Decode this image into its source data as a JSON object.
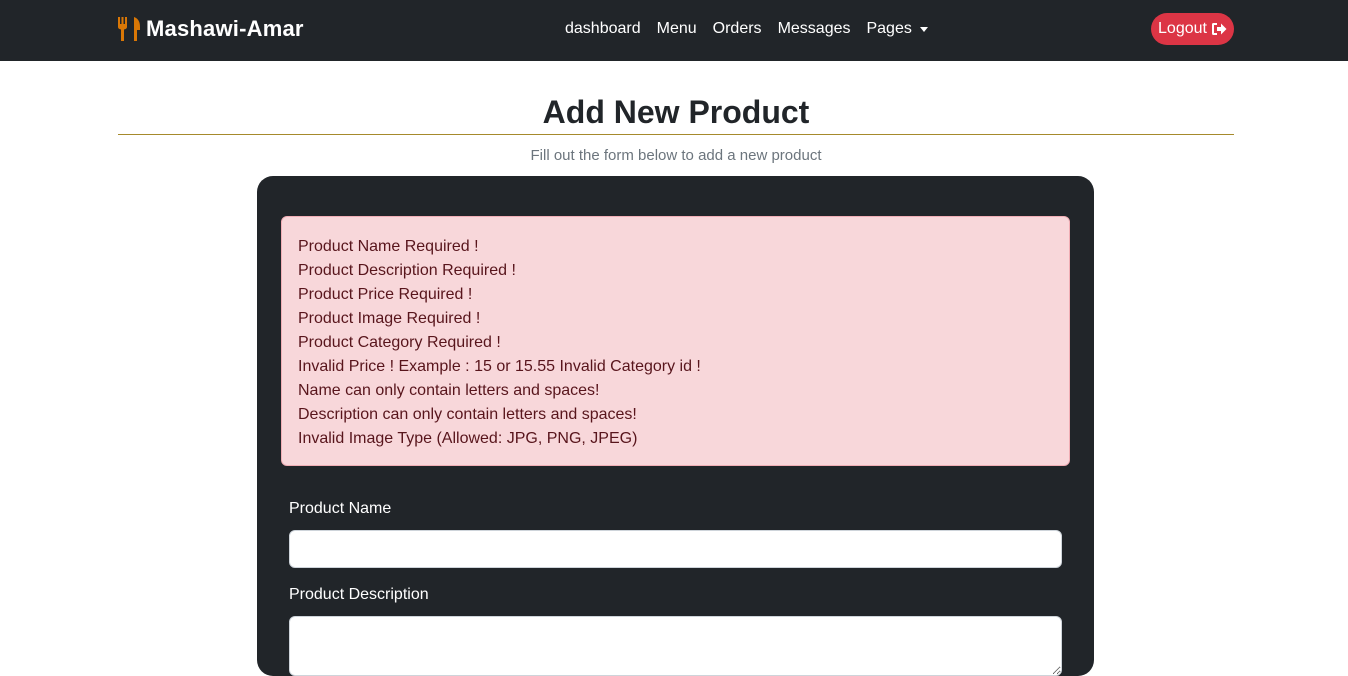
{
  "navbar": {
    "brand": "Mashawi-Amar",
    "links": [
      "dashboard",
      "Menu",
      "Orders",
      "Messages"
    ],
    "dropdown_label": "Pages",
    "logout_label": "Logout"
  },
  "header": {
    "title": "Add New Product",
    "subtitle": "Fill out the form below to add a new product"
  },
  "alert": {
    "messages": [
      "Product Name Required !",
      "Product Description Required !",
      "Product Price Required !",
      "Product Image Required !",
      "Product Category Required !",
      "Invalid Price ! Example : 15 or 15.55 Invalid Category id !",
      "Name can only contain letters and spaces!",
      "Description can only contain letters and spaces!",
      "Invalid Image Type (Allowed: JPG, PNG, JPEG)"
    ]
  },
  "form": {
    "name_label": "Product Name",
    "name_value": "",
    "description_label": "Product Description",
    "description_value": ""
  },
  "icons": {
    "brand": "utensils-icon",
    "logout": "sign-out-icon",
    "dropdown": "caret-down-icon"
  },
  "colors": {
    "navbar_bg": "#212529",
    "brand_icon": "#d97706",
    "logout_bg": "#dc3545",
    "alert_bg": "#f8d7da",
    "alert_text": "#58151c",
    "title_rule": "#a68a2c"
  }
}
